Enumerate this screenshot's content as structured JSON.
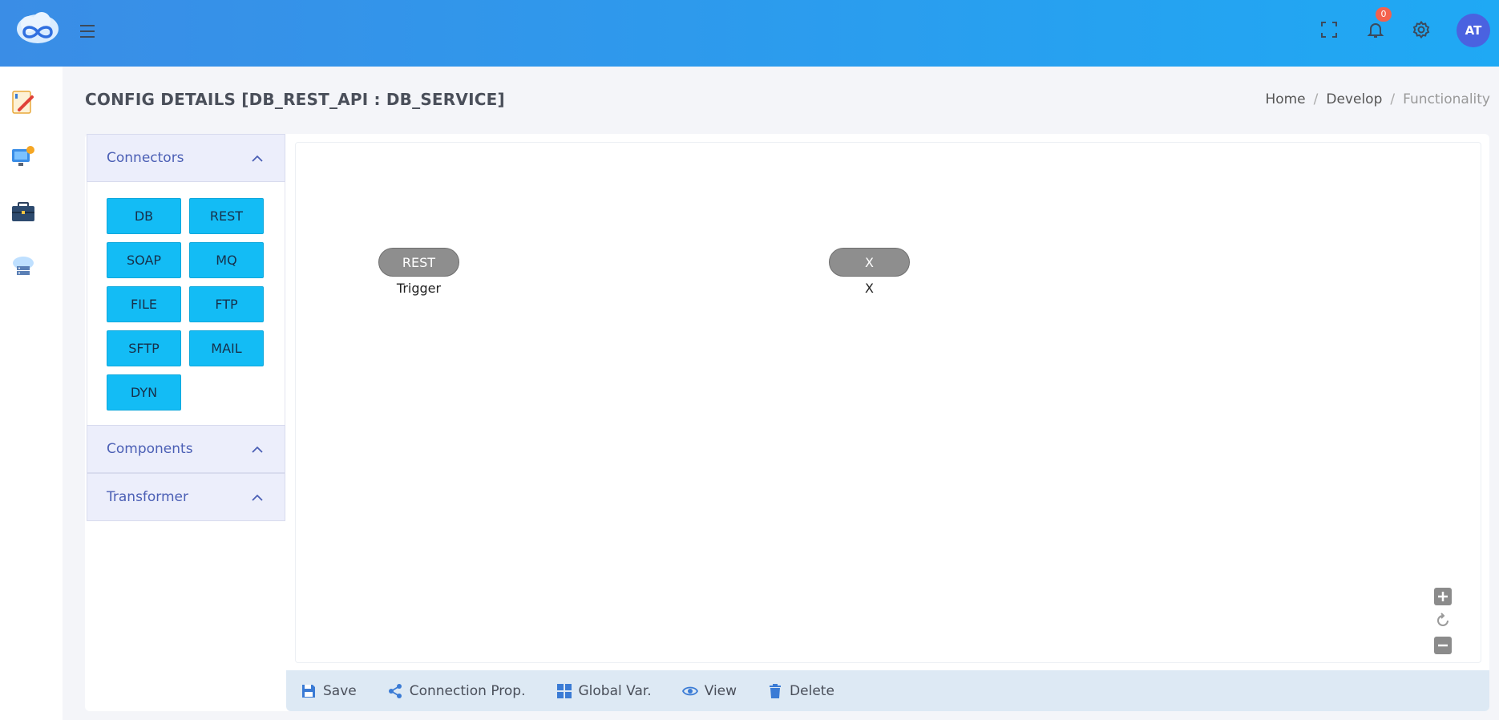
{
  "header": {
    "notification_count": "0",
    "avatar_initials": "AT"
  },
  "page": {
    "title": "CONFIG DETAILS [DB_REST_API : DB_SERVICE]",
    "breadcrumb": [
      "Home",
      "Develop",
      "Functionality"
    ]
  },
  "sidebar": {
    "items": [
      {
        "icon": "edit-document-icon"
      },
      {
        "icon": "monitor-settings-icon"
      },
      {
        "icon": "briefcase-icon"
      },
      {
        "icon": "cloud-server-icon"
      }
    ]
  },
  "panel": {
    "sections": [
      {
        "label": "Connectors",
        "expanded": true
      },
      {
        "label": "Components",
        "expanded": false
      },
      {
        "label": "Transformer",
        "expanded": false
      }
    ],
    "connectors": [
      "DB",
      "REST",
      "SOAP",
      "MQ",
      "FILE",
      "FTP",
      "SFTP",
      "MAIL",
      "DYN"
    ]
  },
  "canvas": {
    "nodes": [
      {
        "text": "REST",
        "label": "Trigger"
      },
      {
        "text": "X",
        "label": "X"
      }
    ]
  },
  "toolbar": {
    "save": "Save",
    "connection": "Connection Prop.",
    "global": "Global Var.",
    "view": "View",
    "delete": "Delete"
  },
  "colors": {
    "topbar_start": "#3a8de6",
    "topbar_end": "#1fa9f4",
    "connector_button": "#13bcf5",
    "node_fill": "#8e8e8e",
    "accent_text": "#4b5fb5"
  }
}
